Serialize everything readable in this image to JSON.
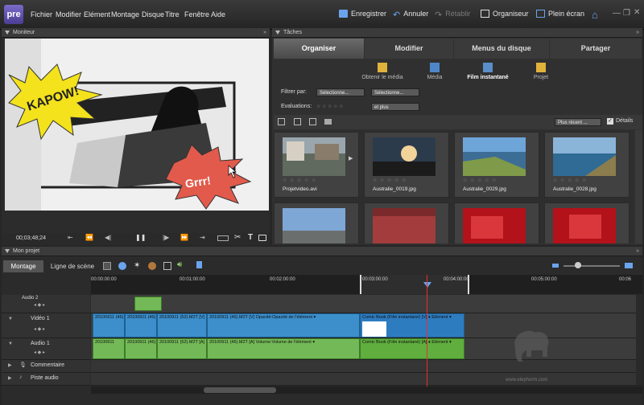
{
  "app": {
    "logo": "pre"
  },
  "menu": [
    "Fichier",
    "Modifier",
    "Elément",
    "Montage",
    "Disque",
    "Titre",
    "Fenêtre",
    "Aide"
  ],
  "toolbar": {
    "save": "Enregistrer",
    "undo": "Annuler",
    "redo": "Rétablir",
    "organizer": "Organiseur",
    "fullscreen": "Plein écran"
  },
  "monitor": {
    "title": "Moniteur",
    "timecode": "00;03;48;24",
    "comic_text_1": "KAPOW!",
    "comic_text_2": "Grrr!"
  },
  "tasks": {
    "title": "Tâches",
    "tabs": [
      "Organiser",
      "Modifier",
      "Menus du disque",
      "Partager"
    ],
    "active_tab": 0,
    "subtabs": [
      "Obtenir le média",
      "Média",
      "Film instantané",
      "Projet"
    ],
    "active_subtab": 2,
    "filter_label": "Filtrer par:",
    "filter_value_1": "Sélectionne...",
    "filter_value_2": "Sélectionne...",
    "ratings_label": "Evaluations:",
    "ratings_stars": "☆ ☆ ☆ ☆ ☆",
    "ratings_mode": "et plus",
    "sort": "Plus récent ...",
    "details_label": "Détails",
    "thumbs": [
      {
        "name": "Projetvideo.avi"
      },
      {
        "name": "Australie_0019.jpg"
      },
      {
        "name": "Australie_0029.jpg"
      },
      {
        "name": "Australie_0028.jpg"
      },
      {
        "name": ""
      },
      {
        "name": ""
      },
      {
        "name": ""
      },
      {
        "name": ""
      }
    ],
    "thumb_stars": "☆ ☆ ☆ ☆ ☆"
  },
  "project": {
    "title": "Mon projet",
    "tabs": [
      "Montage",
      "Ligne de scène"
    ],
    "ruler": [
      "00:00:00:00",
      "00:01:00:00",
      "00:02:00:00",
      "00:03:00:00",
      "00:04:00:00",
      "00:05:00:00",
      "00:06"
    ],
    "tracks": [
      "Audio 2",
      "Vidéo 1",
      "Audio 1",
      "Commentaire",
      "Piste audio"
    ],
    "video_clips": [
      {
        "label": "20100911 (46)"
      },
      {
        "label": "20100911 (46)."
      },
      {
        "label": "20100911 (52).M2T [V]"
      },
      {
        "label": "20100911 (46).M2T [V]   Opacité:Opacité de l'élément ▾"
      },
      {
        "label": "Comic Book (Film instantané) [V]   ♦ Elément ▾"
      }
    ],
    "audio_clips": [
      {
        "label": "20100911"
      },
      {
        "label": "20100911 (46)."
      },
      {
        "label": "20100911 (52).M2T [A]"
      },
      {
        "label": "20100911 (46).M2T [A]   Volume:Volume de l'élément ▾"
      },
      {
        "label": "Comic Book (Film instantané) [A]   ♦ Elément ▾"
      }
    ],
    "watermark": "www.elephorm.com"
  },
  "colors": {
    "video_clip": "#3c8fcb",
    "audio_clip": "#74b957",
    "playhead": "#e23030",
    "accent": "#4f7fd0"
  }
}
